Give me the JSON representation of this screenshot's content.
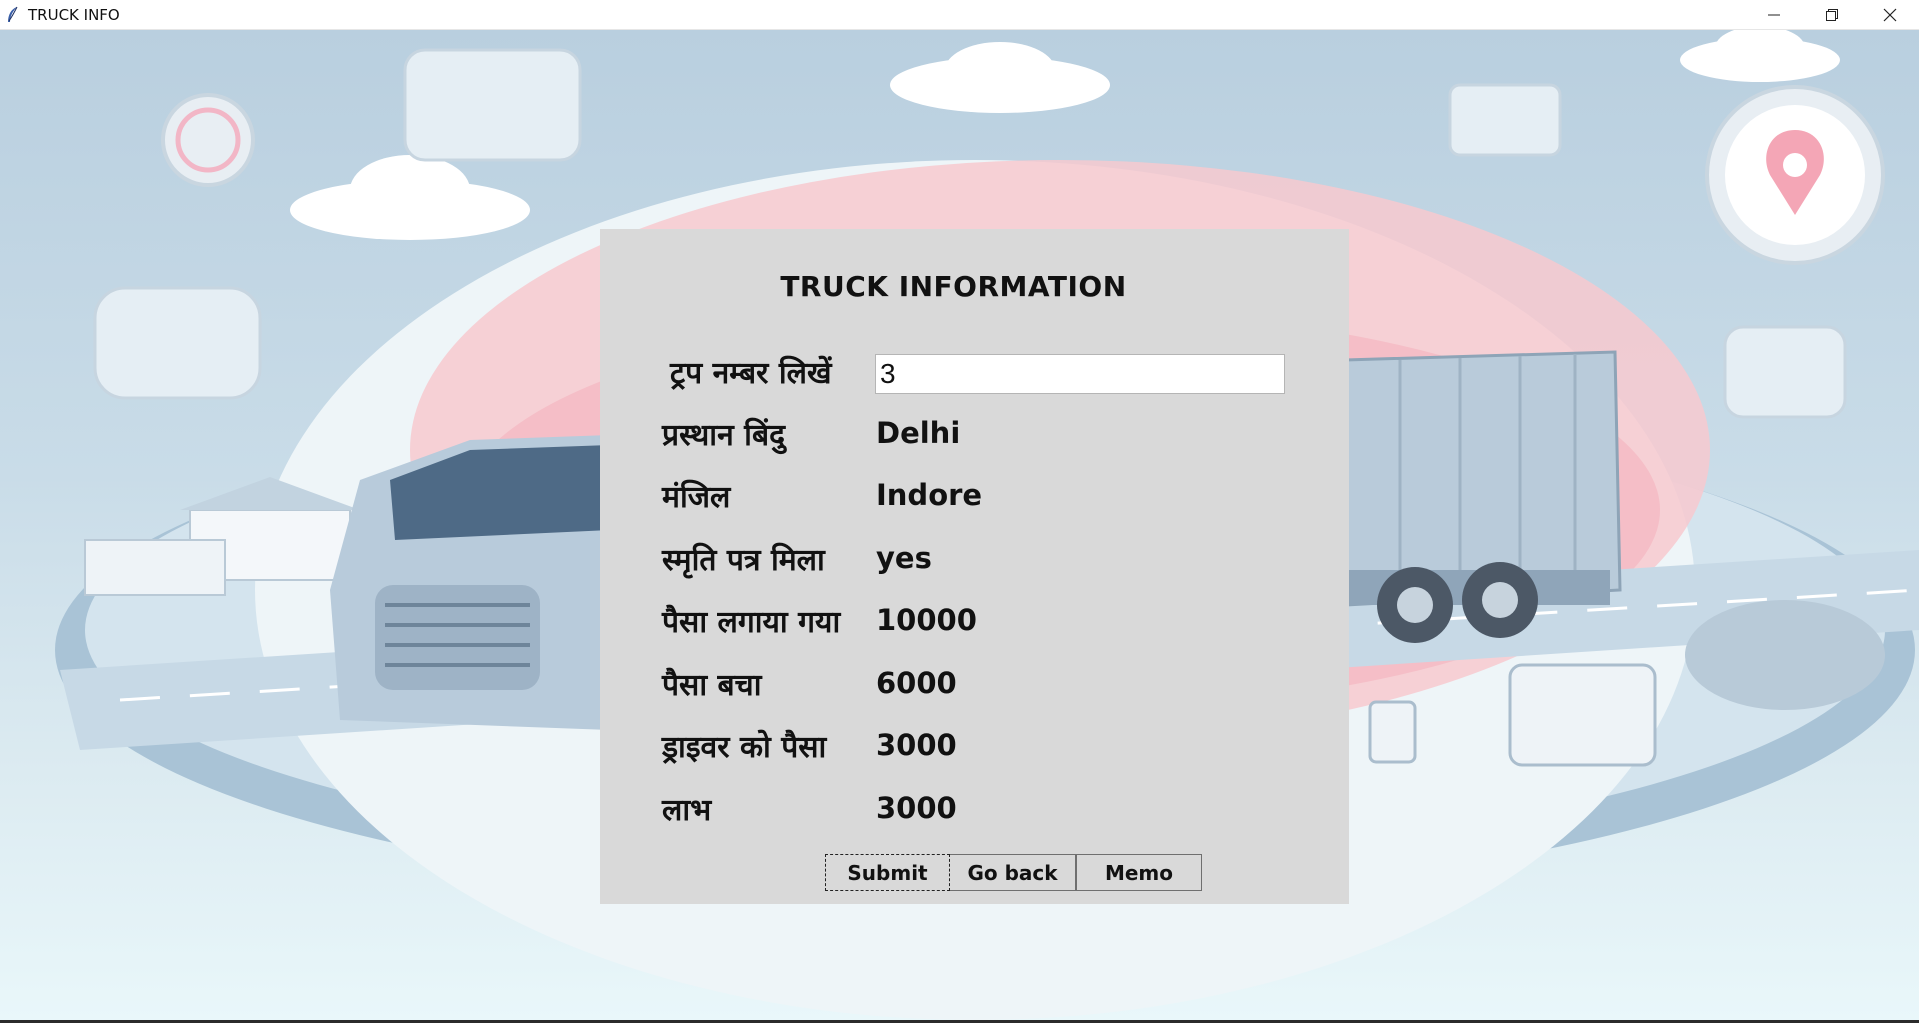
{
  "window": {
    "title": "TRUCK INFO",
    "icons": [
      "feather-icon",
      "minimize-icon",
      "restore-icon",
      "close-icon"
    ]
  },
  "form": {
    "title": "TRUCK INFORMATION",
    "trip_number": {
      "label": "ट्रप नम्बर लिखें",
      "value": "3"
    },
    "rows": [
      {
        "label": "प्रस्थान बिंदु",
        "value": "Delhi"
      },
      {
        "label": "मंजिल",
        "value": "Indore"
      },
      {
        "label": "स्मृति पत्र मिला",
        "value": "yes"
      },
      {
        "label": "पैसा लगाया गया",
        "value": "10000"
      },
      {
        "label": "पैसा बचा",
        "value": "6000"
      },
      {
        "label": "ड्राइवर को पैसा",
        "value": "3000"
      },
      {
        "label": "लाभ",
        "value": "3000"
      }
    ],
    "buttons": {
      "submit": "Submit",
      "go_back": "Go back",
      "memo": "Memo"
    }
  },
  "colors": {
    "panel_bg": "#d9d9d9",
    "scene_sky": "#b9cfdf",
    "accent_pink": "#f4a6b6"
  }
}
